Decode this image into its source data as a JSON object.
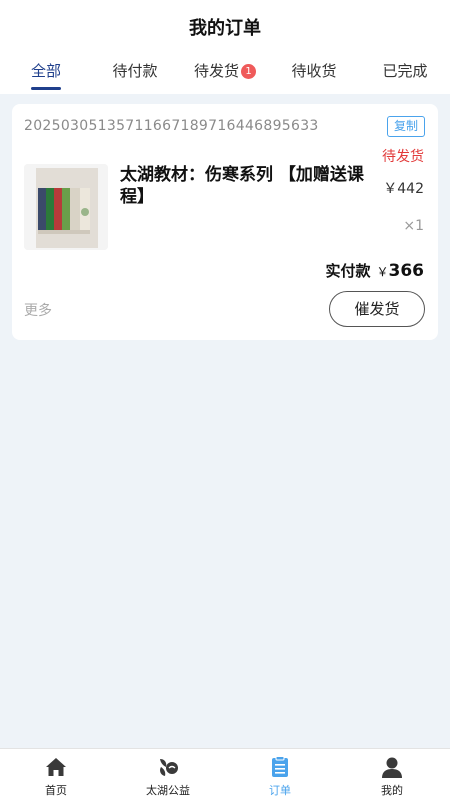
{
  "header": {
    "title": "我的订单"
  },
  "tabs": [
    {
      "label": "全部"
    },
    {
      "label": "待付款"
    },
    {
      "label": "待发货",
      "badge": "1"
    },
    {
      "label": "待收货"
    },
    {
      "label": "已完成"
    }
  ],
  "order": {
    "number": "20250305135711667189716446895633",
    "copy_label": "复制",
    "status": "待发货",
    "product_title": "太湖教材：伤寒系列 【加赠送课程】",
    "price": "￥442",
    "quantity": "×1",
    "paid_label": "实付款",
    "paid_currency": "￥",
    "paid_amount": "366",
    "more_label": "更多",
    "urge_label": "催发货"
  },
  "tabbar": [
    {
      "label": "首页",
      "icon": "home-icon"
    },
    {
      "label": "太湖公益",
      "icon": "charity-icon"
    },
    {
      "label": "订单",
      "icon": "order-icon"
    },
    {
      "label": "我的",
      "icon": "user-icon"
    }
  ],
  "colors": {
    "accent": "#1f3f8c",
    "tabbar_active": "#4aa3ec",
    "status_red": "#e23a3a",
    "background": "#eef3f8"
  }
}
